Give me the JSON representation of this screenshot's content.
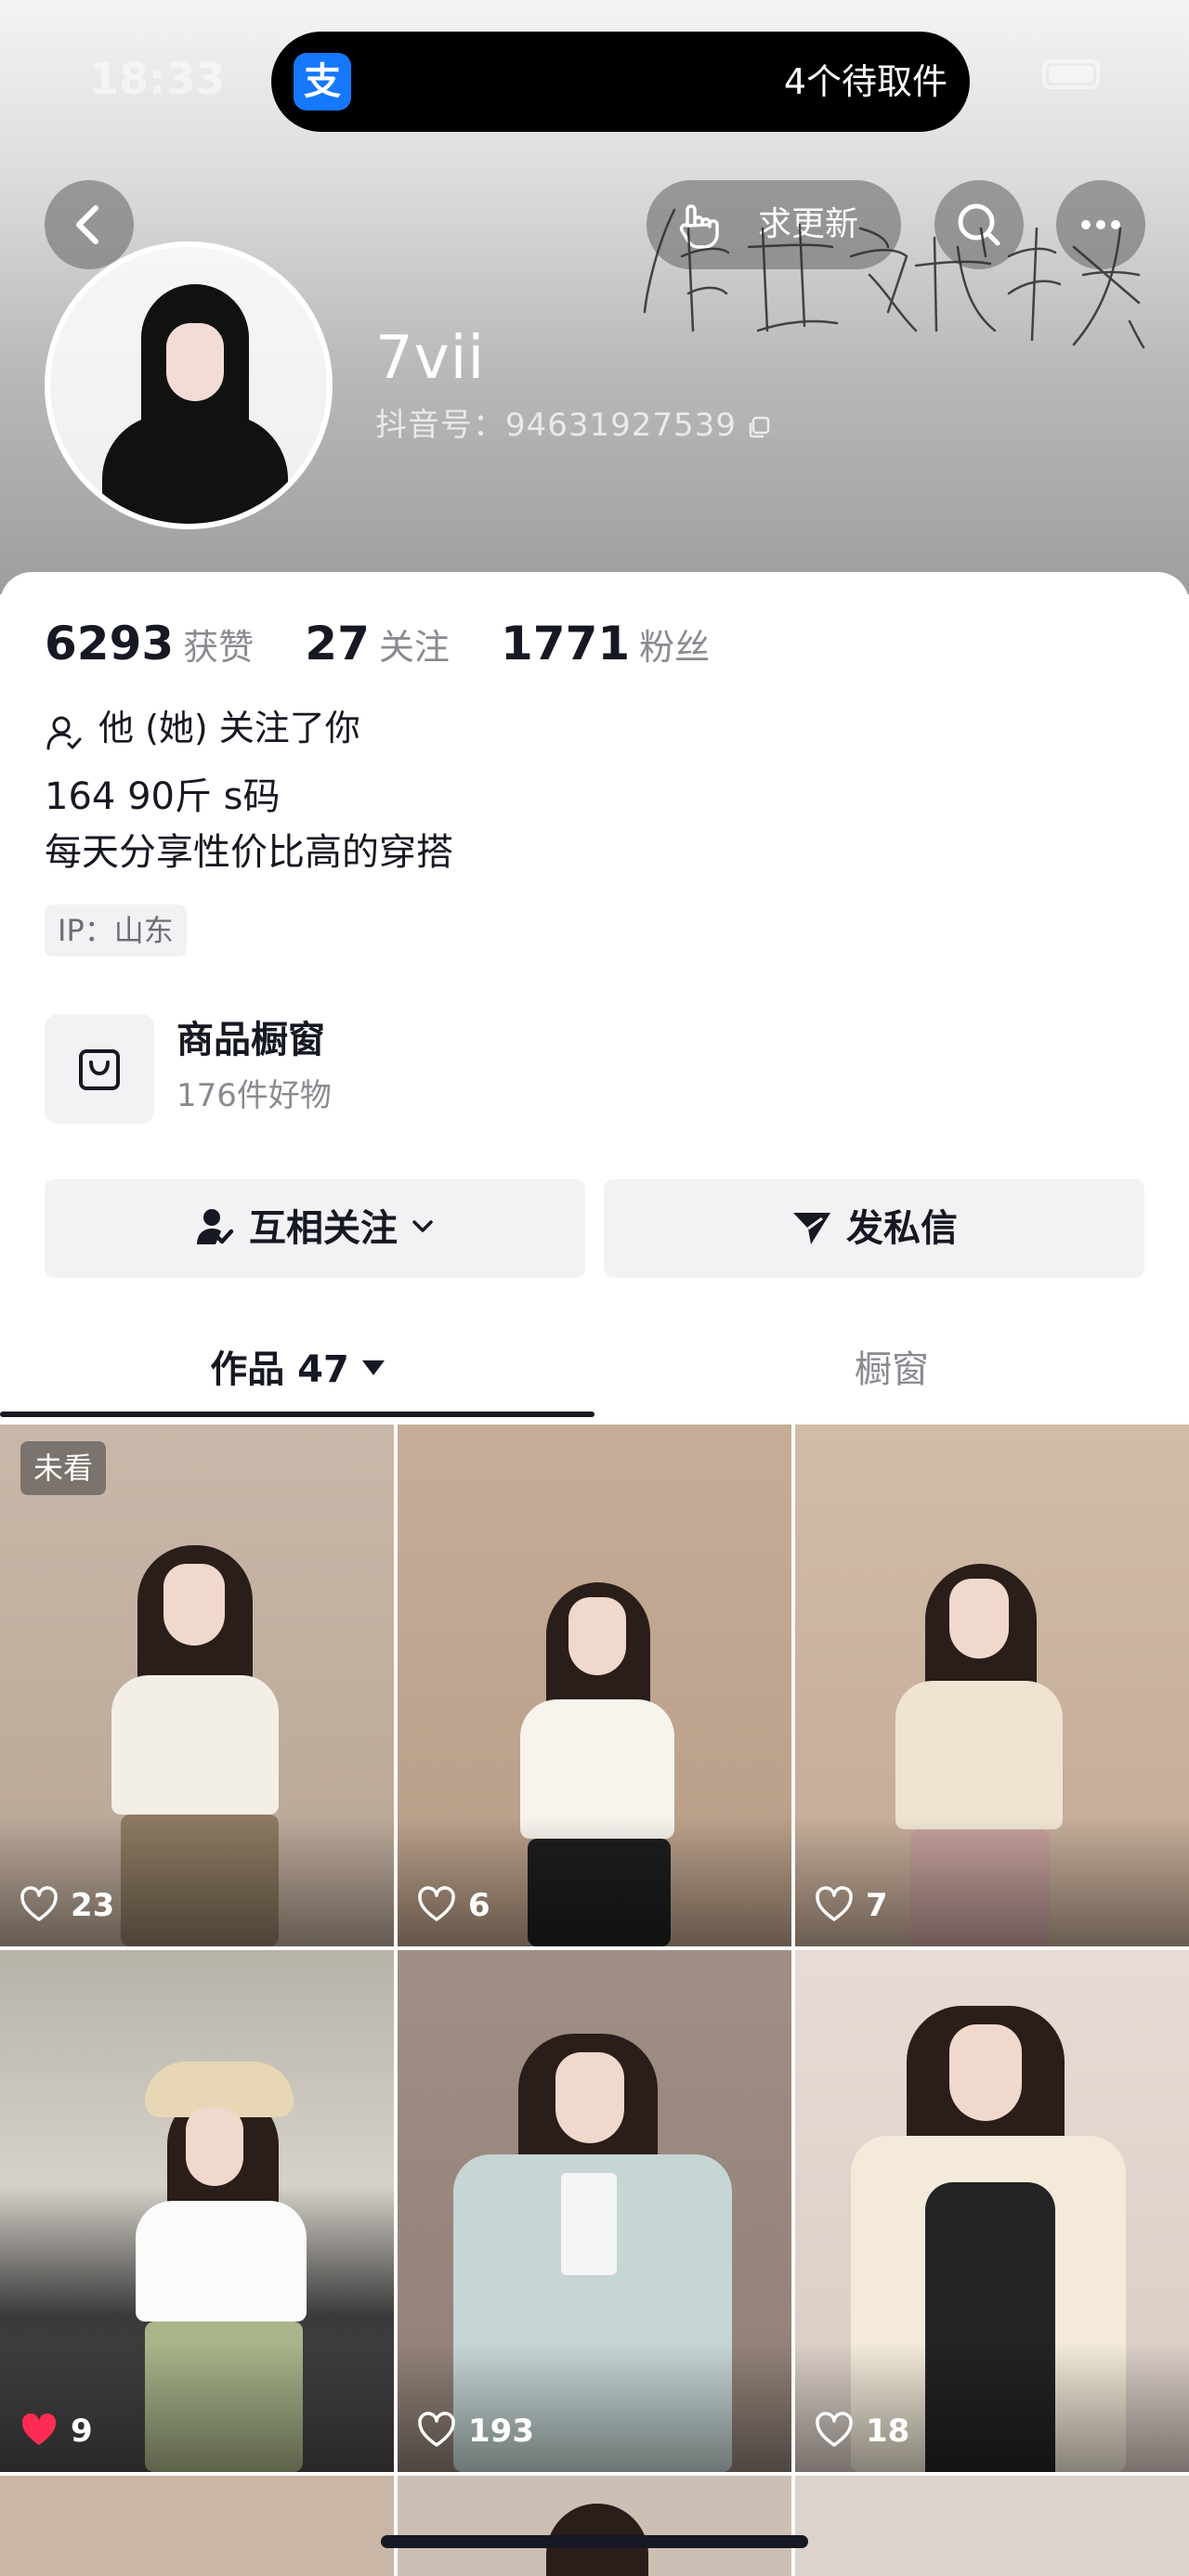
{
  "status_bar": {
    "time": "18:33"
  },
  "dynamic_island": {
    "app_icon_label": "支",
    "text": "4个待取件"
  },
  "header": {
    "update_button": "求更新",
    "username": "7vii",
    "douyin_id": "抖音号：94631927539"
  },
  "stats": [
    {
      "value": "6293",
      "label": "获赞"
    },
    {
      "value": "27",
      "label": "关注"
    },
    {
      "value": "1771",
      "label": "粉丝"
    }
  ],
  "follows_you": "他 (她) 关注了你",
  "bio": [
    "164 90斤 s码",
    "每天分享性价比高的穿搭"
  ],
  "ip_location": "IP：山东",
  "shop": {
    "title": "商品橱窗",
    "subtitle": "176件好物"
  },
  "actions": {
    "follow": "互相关注",
    "message": "发私信"
  },
  "tabs": {
    "works": "作品 47",
    "window": "橱窗"
  },
  "videos": [
    {
      "likes": "23",
      "unseen_label": "未看",
      "liked": false
    },
    {
      "likes": "6",
      "liked": false
    },
    {
      "likes": "7",
      "liked": false
    },
    {
      "likes": "9",
      "liked": true
    },
    {
      "likes": "193",
      "liked": false
    },
    {
      "likes": "18",
      "liked": false
    }
  ],
  "colors": {
    "liked_heart": "#fe2c55",
    "alipay_blue": "#1677ff",
    "text_primary": "#161823",
    "text_secondary": "#8a8b91"
  }
}
